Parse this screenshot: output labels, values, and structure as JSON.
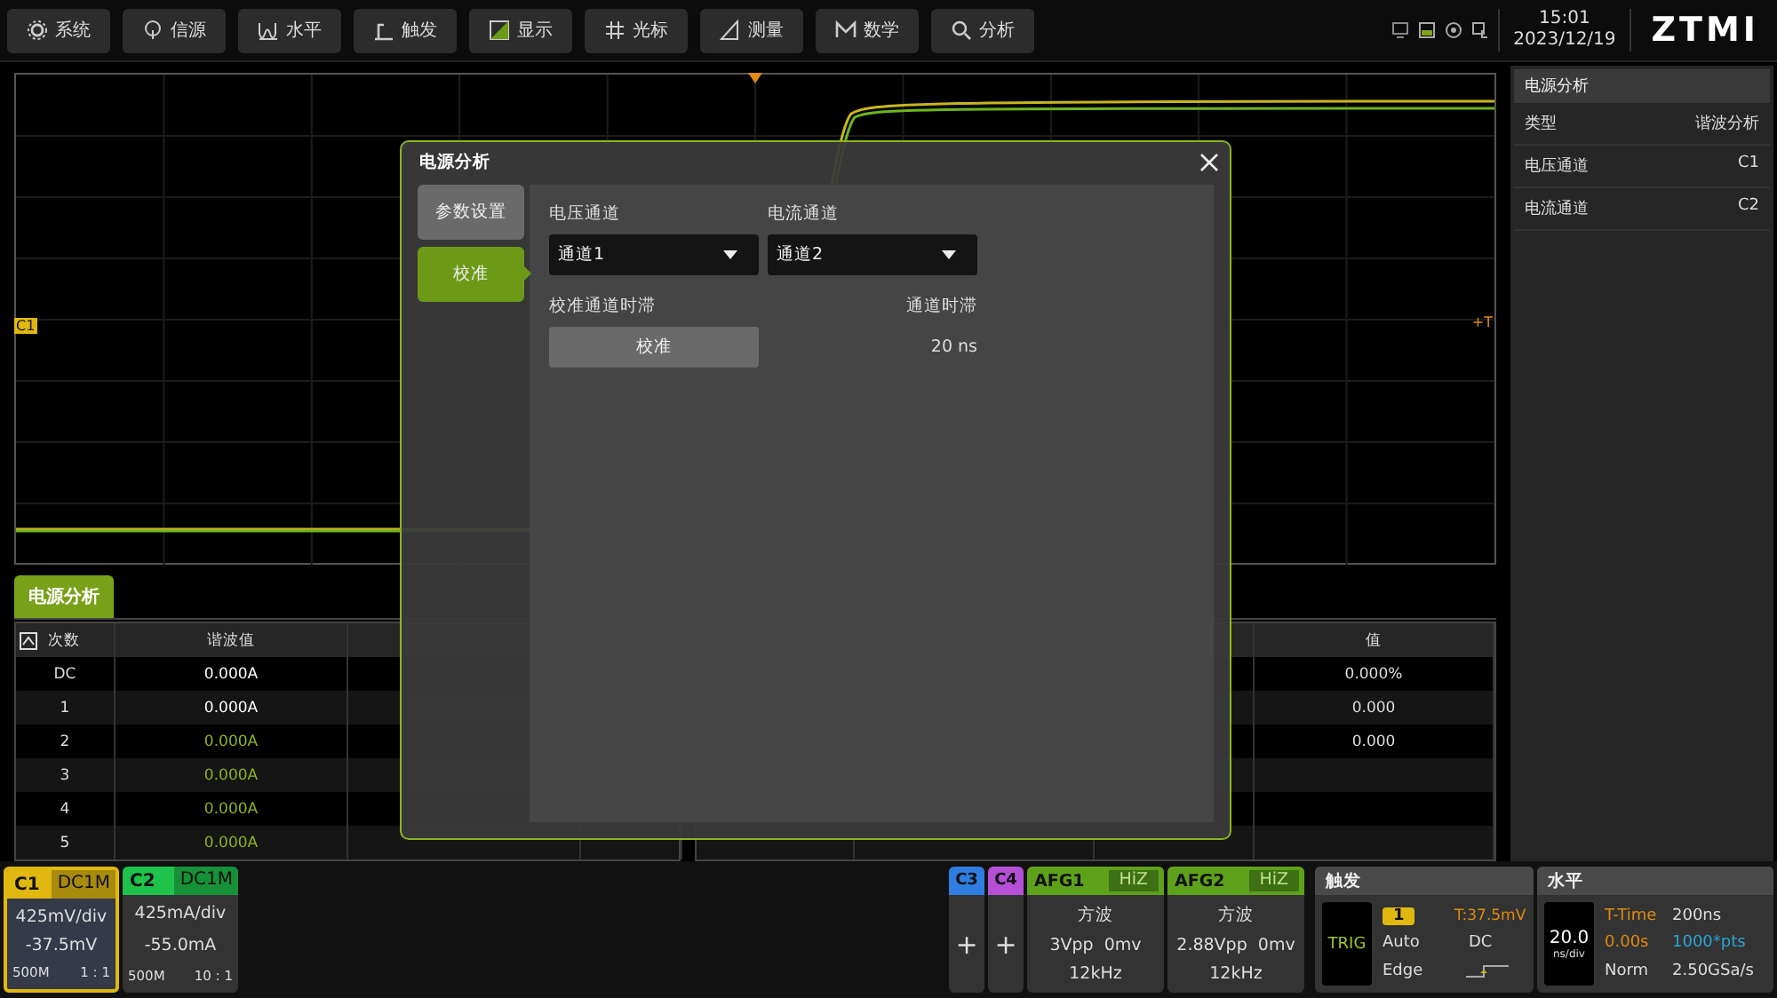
{
  "toolbar": {
    "buttons": [
      {
        "label": "系统"
      },
      {
        "label": "信源"
      },
      {
        "label": "水平"
      },
      {
        "label": "触发"
      },
      {
        "label": "显示"
      },
      {
        "label": "光标"
      },
      {
        "label": "测量"
      },
      {
        "label": "数学"
      },
      {
        "label": "分析"
      }
    ]
  },
  "status": {
    "time": "15:01",
    "date": "2023/12/19",
    "logo": "ZTMI"
  },
  "scope": {
    "channel_marker": "C1",
    "trigger_marker": "+T"
  },
  "side_panel": {
    "title": "电源分析",
    "rows": [
      {
        "label": "类型",
        "value": "谐波分析"
      },
      {
        "label": "电压通道",
        "value": "C1"
      },
      {
        "label": "电流通道",
        "value": "C2"
      }
    ]
  },
  "result_tab": {
    "label": "电源分析",
    "selected": true
  },
  "harmonics_table": {
    "columns": [
      "次数",
      "谐波值"
    ],
    "rows": [
      {
        "order": "DC",
        "value": "0.000A",
        "color": "#ffffff"
      },
      {
        "order": "1",
        "value": "0.000A",
        "color": "#ffffff"
      },
      {
        "order": "2",
        "value": "0.000A",
        "color": "#8db41e"
      },
      {
        "order": "3",
        "value": "0.000A",
        "color": "#8db41e"
      },
      {
        "order": "4",
        "value": "0.000A",
        "color": "#8db41e"
      },
      {
        "order": "5",
        "value": "0.000A",
        "color": "#8db41e"
      }
    ]
  },
  "summary_table": {
    "column": "值",
    "rows": [
      "0.000%",
      "0.000",
      "0.000"
    ]
  },
  "dialog": {
    "title": "电源分析",
    "tabs": [
      {
        "label": "参数设置",
        "selected": false
      },
      {
        "label": "校准",
        "selected": true
      }
    ],
    "voltage_channel": {
      "label": "电压通道",
      "value": "通道1"
    },
    "current_channel": {
      "label": "电流通道",
      "value": "通道2"
    },
    "calibrate": {
      "label": "校准通道时滞",
      "button": "校准"
    },
    "skew": {
      "label": "通道时滞",
      "value": "20 ns"
    }
  },
  "channels": [
    {
      "name": "C1",
      "coupling": "DC1M",
      "scale": "425mV/div",
      "offset": "-37.5mV",
      "bandwidth": "500M",
      "probe": "1 : 1",
      "color": "#e0b810",
      "selected": true
    },
    {
      "name": "C2",
      "coupling": "DC1M",
      "scale": "425mA/div",
      "offset": "-55.0mA",
      "bandwidth": "500M",
      "probe": "10 : 1",
      "color": "#1fc24a",
      "selected": false
    }
  ],
  "empty_channels": [
    {
      "name": "C3",
      "color": "#2f7de0",
      "button": "+"
    },
    {
      "name": "C4",
      "color": "#b450d6",
      "button": "+"
    }
  ],
  "afg": [
    {
      "name": "AFG1",
      "load": "HiZ",
      "wave": "方波",
      "amplitude": "3Vpp",
      "offset": "0mv",
      "frequency": "12kHz"
    },
    {
      "name": "AFG2",
      "load": "HiZ",
      "wave": "方波",
      "amplitude": "2.88Vpp",
      "offset": "0mv",
      "frequency": "12kHz"
    }
  ],
  "trigger": {
    "title": "触发",
    "status": "TRIG",
    "source": "1",
    "level": "T:37.5mV",
    "mode": "Auto",
    "coupling": "DC",
    "type": "Edge"
  },
  "horizontal": {
    "title": "水平",
    "scale": "20.0",
    "scale_unit": "ns/div",
    "time_label": "T-Time",
    "time_value": "200ns",
    "position": "0.00s",
    "points": "1000*pts",
    "acq_mode": "Norm",
    "sample_rate": "2.50GSa/s"
  }
}
